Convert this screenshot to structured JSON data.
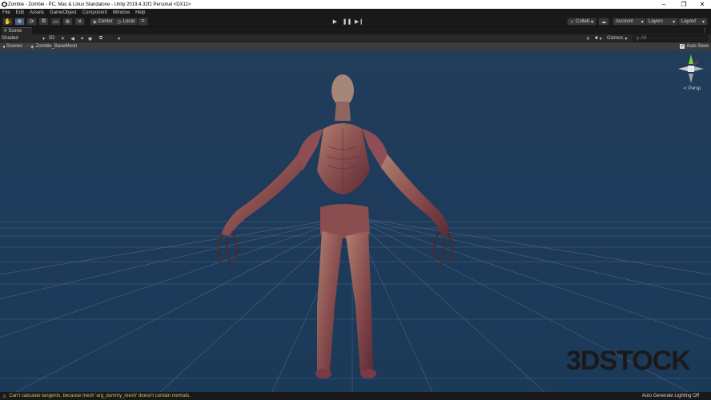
{
  "window": {
    "title": "Zombie - Zombie - PC, Mac & Linux Standalone - Unity 2019.4.32f1 Personal <DX11>",
    "controls": [
      "–",
      "❐",
      "✕"
    ]
  },
  "menu": [
    "File",
    "Edit",
    "Assets",
    "GameObject",
    "Component",
    "Window",
    "Help"
  ],
  "toolbar": {
    "tools": [
      "hand-tool",
      "move-tool",
      "rotate-tool",
      "scale-tool",
      "rect-tool",
      "transform-tool",
      "custom-tool"
    ],
    "active_tool": "move-tool",
    "pivot_label": "Center",
    "space_label": "Local",
    "collab_label": "Collab",
    "account_label": "Account",
    "layers_label": "Layers",
    "layout_label": "Layout"
  },
  "scene_tab": {
    "label": "Scene"
  },
  "scene_header": {
    "shading_mode": "Shaded",
    "mode_2d": "2D",
    "gizmos_label": "Gizmos",
    "search_placeholder": "All"
  },
  "breadcrumb": {
    "scenes_label": "Scenes",
    "prefab_label": "Zombie_BaseMesh",
    "autosave_label": "Auto Save",
    "autosave_checked": true
  },
  "viewport": {
    "projection_label": "Persp",
    "watermark_text": "3DSTOCK",
    "background_color": "#1e3b5b",
    "grid_color": "#6f87a0"
  },
  "status": {
    "warning_text": "Can't calculate tangents, because mesh 'arg_dummy_mesh' doesn't contain normals.",
    "lighting_text": "Auto Generate Lighting Off"
  }
}
